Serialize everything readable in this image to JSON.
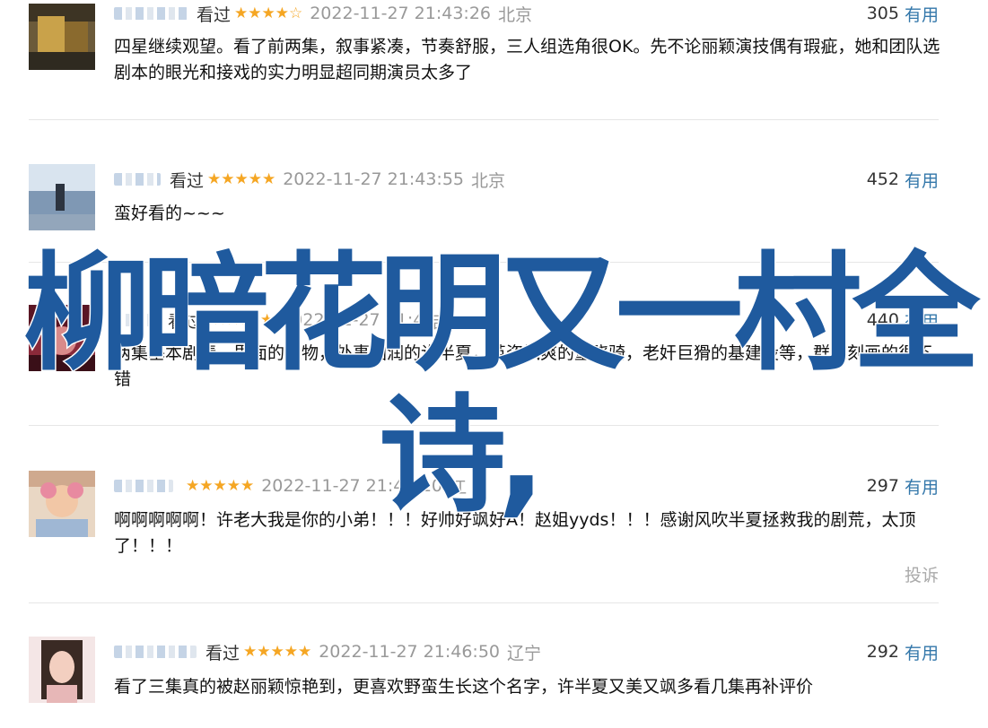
{
  "overlay": {
    "line1": "柳暗花明又一村全",
    "line2": "诗,"
  },
  "reviews": [
    {
      "status": "看过",
      "stars": "★★★★☆",
      "timestamp": "2022-11-27 21:43:26",
      "location": "北京",
      "votes": "305",
      "useful_label": "有用",
      "content": "四星继续观望。看了前两集，叙事紧凑，节奏舒服，三人组选角很OK。先不论丽颖演技偶有瑕疵，她和团队选剧本的眼光和接戏的实力明显超同期演员太多了"
    },
    {
      "status": "看过",
      "stars": "★★★★★",
      "timestamp": "2022-11-27 21:43:55",
      "location": "北京",
      "votes": "452",
      "useful_label": "有用",
      "content": "蛮好看的~~~"
    },
    {
      "status": "看过",
      "stars": "★★★★★",
      "timestamp": "2022-11-27 21:4",
      "location": "吉",
      "votes": "440",
      "useful_label": "有用",
      "content": "两集基本剧情，里面的人物，处事圆润的许半夏，英姿飒爽的童骁骑，老奸巨猾的基建设等，群像刻画的很不错"
    },
    {
      "status": "",
      "stars": "★★★★★",
      "timestamp": "2022-11-27 21:44:10",
      "location": "江",
      "votes": "297",
      "useful_label": "有用",
      "content": "啊啊啊啊啊！许老大我是你的小弟！！！好帅好飒好A！赵姐yyds！！！感谢风吹半夏拯救我的剧荒，太顶了！！！",
      "report_label": "投诉"
    },
    {
      "status": "看过",
      "stars": "★★★★★",
      "timestamp": "2022-11-27 21:46:50",
      "location": "辽宁",
      "votes": "292",
      "useful_label": "有用",
      "content": "看了三集真的被赵丽颖惊艳到，更喜欢野蛮生长这个名字，许半夏又美又飒多看几集再补评价"
    }
  ],
  "colors": {
    "link": "#3377aa",
    "star": "#f5a623",
    "muted": "#999999",
    "overlay_text": "#1f5a9e"
  }
}
